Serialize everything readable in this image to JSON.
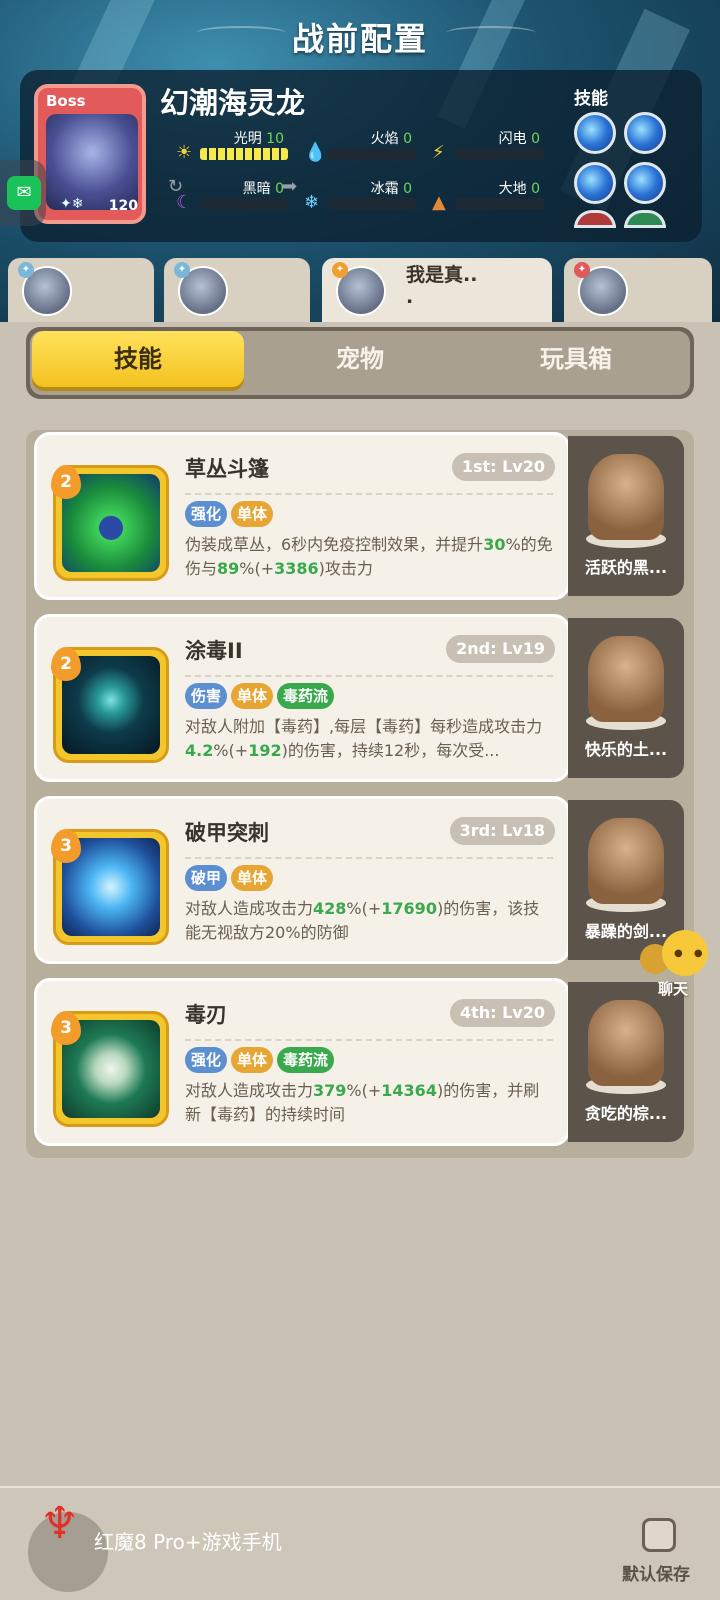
{
  "title": "战前配置",
  "boss": {
    "tag": "Boss",
    "name": "幻潮海灵龙",
    "level": "120",
    "elements": [
      {
        "name": "光明",
        "value": "10",
        "fill": 1.0,
        "icon": "☀",
        "color": "#f4d23a"
      },
      {
        "name": "火焰",
        "value": "0",
        "fill": 0,
        "icon": "💧",
        "color": "#e04a3a"
      },
      {
        "name": "闪电",
        "value": "0",
        "fill": 0,
        "icon": "⚡",
        "color": "#f4d23a"
      },
      {
        "name": "黑暗",
        "value": "0",
        "fill": 0,
        "icon": "☾",
        "color": "#b05ad8"
      },
      {
        "name": "冰霜",
        "value": "0",
        "fill": 0,
        "icon": "❄",
        "color": "#6fd0ff"
      },
      {
        "name": "大地",
        "value": "0",
        "fill": 0,
        "icon": "▲",
        "color": "#e08a3a"
      }
    ],
    "skills_label": "技能"
  },
  "team": [
    {
      "name": "",
      "badge_color": "#7bb7d6",
      "active": false
    },
    {
      "name": "",
      "badge_color": "#7bb7d6",
      "active": false
    },
    {
      "name": "我是真..",
      "name2": ".",
      "badge_color": "#f0a030",
      "active": true
    },
    {
      "name": "",
      "badge_color": "#e05a5a",
      "active": false
    }
  ],
  "tabs": [
    "技能",
    "宠物",
    "玩具箱"
  ],
  "active_tab": 0,
  "skills": [
    {
      "order": "2",
      "name": "草丛斗篷",
      "level": "1st: Lv20",
      "tags": [
        {
          "text": "强化",
          "color": "blue"
        },
        {
          "text": "单体",
          "color": "orange"
        }
      ],
      "desc_parts": [
        "伪装成草丛，6秒内免疫控制效果，并提升",
        "30",
        "%的免伤与",
        "89",
        "%(+",
        "3386",
        ")攻击力"
      ],
      "art": "grass"
    },
    {
      "order": "2",
      "name": "涂毒II",
      "level": "2nd: Lv19",
      "tags": [
        {
          "text": "伤害",
          "color": "blue"
        },
        {
          "text": "单体",
          "color": "orange"
        },
        {
          "text": "毒药流",
          "color": "green"
        }
      ],
      "desc_parts": [
        "对敌人附加【毒药】,每层【毒药】每秒造成攻击力",
        "4.2",
        "%(+",
        "192",
        ")的伤害，持续12秒，每次受..."
      ],
      "art": "poison"
    },
    {
      "order": "3",
      "name": "破甲突刺",
      "level": "3rd: Lv18",
      "tags": [
        {
          "text": "破甲",
          "color": "blue"
        },
        {
          "text": "单体",
          "color": "orange"
        }
      ],
      "desc_parts": [
        "对敌人造成攻击力",
        "428",
        "%(+",
        "17690",
        ")的伤害，该技能无视敌方20%的防御"
      ],
      "art": "pierce"
    },
    {
      "order": "3",
      "name": "毒刃",
      "level": "4th: Lv20",
      "tags": [
        {
          "text": "强化",
          "color": "blue"
        },
        {
          "text": "单体",
          "color": "orange"
        },
        {
          "text": "毒药流",
          "color": "green"
        }
      ],
      "desc_parts": [
        "对敌人造成攻击力",
        "379",
        "%(+",
        "14364",
        ")的伤害，并刷新【毒药】的持续时间"
      ],
      "art": "blade"
    }
  ],
  "pets": [
    "活跃的黑...",
    "快乐的土...",
    "暴躁的剑...",
    "贪吃的棕..."
  ],
  "chat_label": "聊天",
  "bottom": {
    "brand": "红魔8 Pro+游戏手机",
    "save_label": "默认保存"
  }
}
